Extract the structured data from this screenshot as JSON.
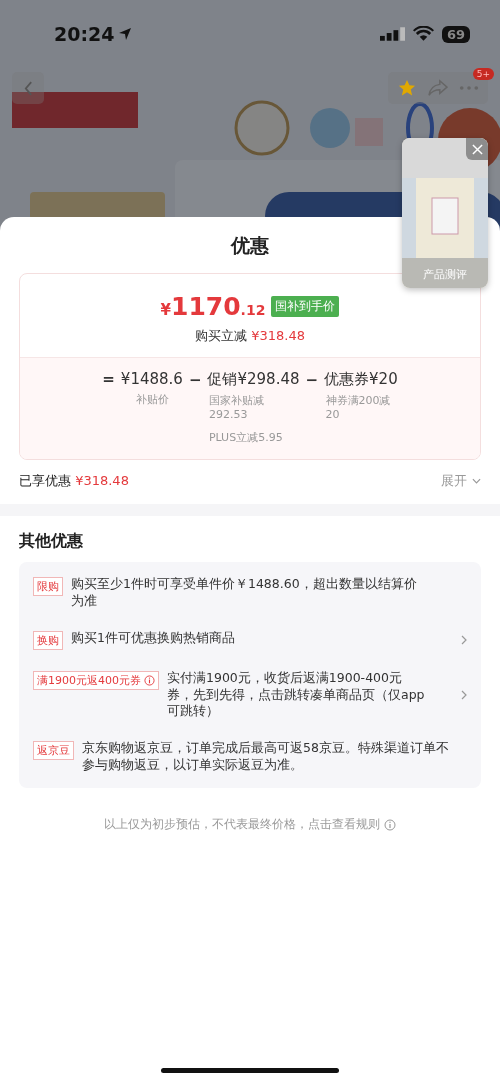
{
  "status_bar": {
    "time": "20:24",
    "battery": "69"
  },
  "nav": {
    "badge": "5+"
  },
  "floating_video": {
    "label": "产品测评"
  },
  "sheet": {
    "title": "优惠",
    "price": {
      "currency": "¥",
      "integer": "1170",
      "decimal": ".12",
      "tag": "国补到手价",
      "reduction_label": "购买立减",
      "reduction": "¥318.48"
    },
    "breakdown": [
      {
        "op": "=",
        "amount": "¥1488.6",
        "notes": [
          "补贴价"
        ]
      },
      {
        "op": "−",
        "amount": "促销¥298.48",
        "notes": [
          "国家补贴减\n292.53",
          "PLUS立减5.95"
        ]
      },
      {
        "op": "−",
        "amount": "优惠券¥20",
        "notes": [
          "神券满200减\n20"
        ]
      }
    ],
    "enjoyed": {
      "label": "已享优惠",
      "amount": "¥318.48",
      "expand": "展开"
    },
    "other_title": "其他优惠",
    "offers": [
      {
        "tag": "限购",
        "info": false,
        "text": "购买至少1件时可享受单件价￥1488.60，超出数量以结算价为准",
        "arrow": false
      },
      {
        "tag": "换购",
        "info": false,
        "text": "购买1件可优惠换购热销商品",
        "arrow": true
      },
      {
        "tag": "满1900元返400元券",
        "info": true,
        "text": "实付满1900元，收货后返满1900-400元券，先到先得，点击跳转凑单商品页（仅app可跳转）",
        "arrow": true
      },
      {
        "tag": "返京豆",
        "info": false,
        "text": "京东购物返京豆，订单完成后最高可返58京豆。特殊渠道订单不参与购物返豆，以订单实际返豆为准。",
        "arrow": false
      }
    ],
    "footnote": "以上仅为初步预估，不代表最终价格，点击查看规则"
  }
}
